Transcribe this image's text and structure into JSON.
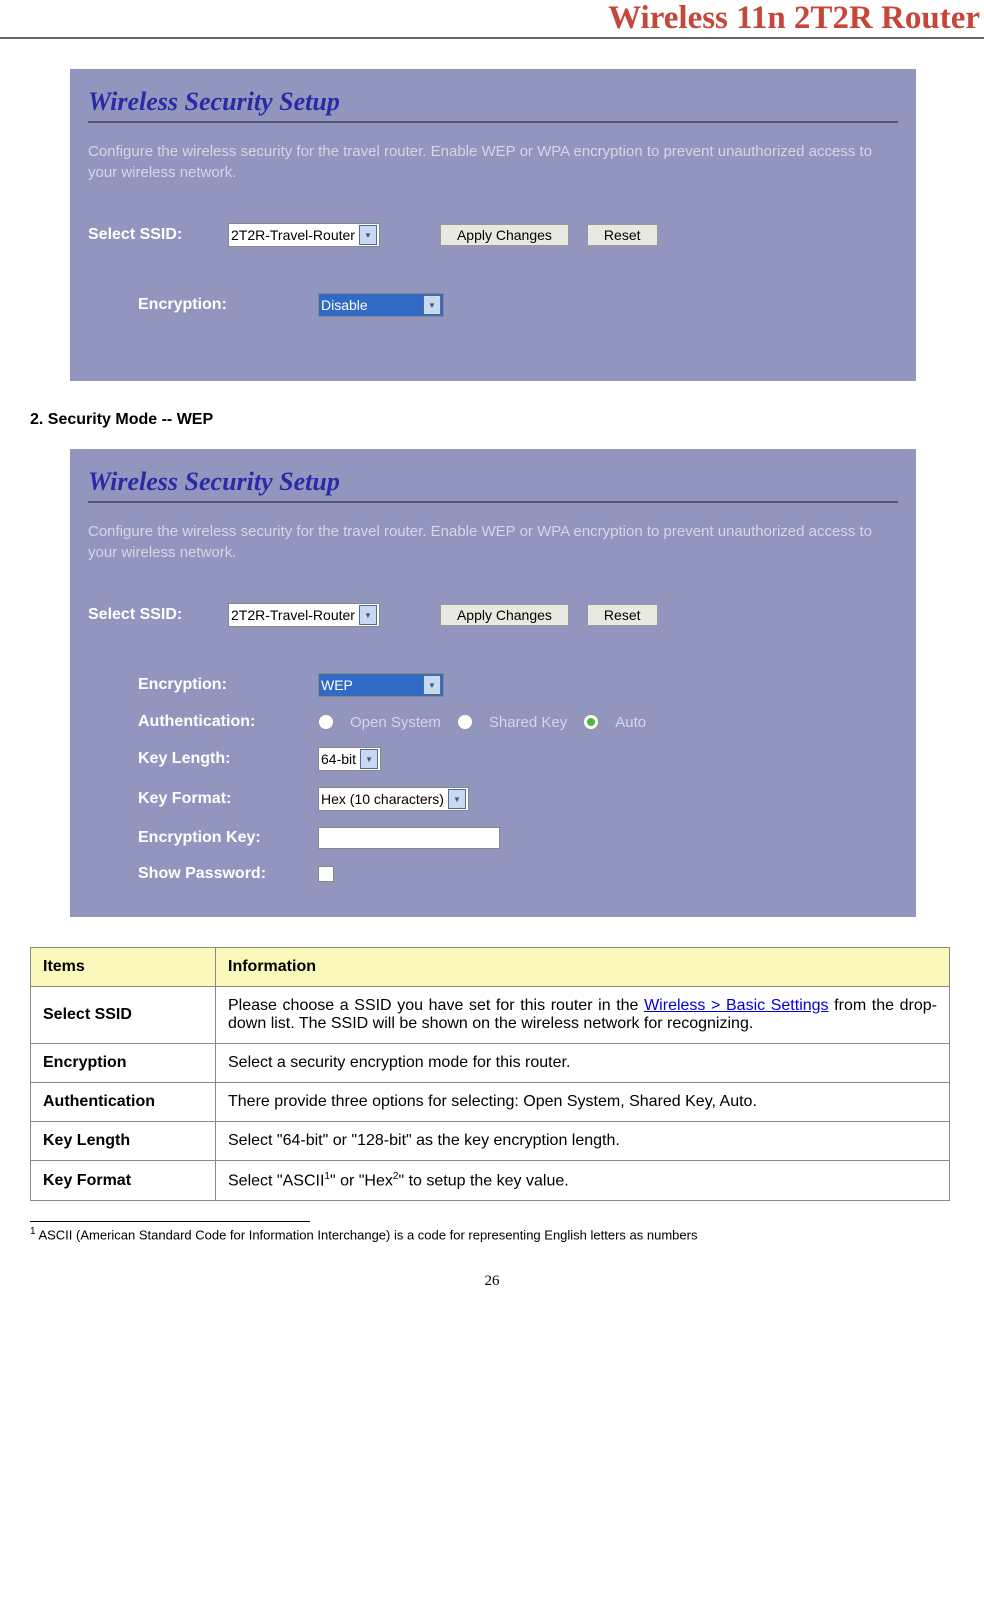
{
  "header": {
    "title": "Wireless 11n 2T2R Router"
  },
  "screenshot1": {
    "title": "Wireless Security Setup",
    "description": "Configure the wireless security for the travel router. Enable WEP or WPA encryption to prevent unauthorized access to your wireless network.",
    "ssid_label": "Select SSID:",
    "ssid_value": "2T2R-Travel-Router",
    "apply_btn": "Apply Changes",
    "reset_btn": "Reset",
    "encryption_label": "Encryption:",
    "encryption_value": "Disable"
  },
  "section_heading": "2.  Security Mode -- WEP",
  "screenshot2": {
    "title": "Wireless Security Setup",
    "description": "Configure the wireless security for the travel router. Enable WEP or WPA encryption to prevent unauthorized access to your wireless network.",
    "ssid_label": "Select SSID:",
    "ssid_value": "2T2R-Travel-Router",
    "apply_btn": "Apply Changes",
    "reset_btn": "Reset",
    "encryption_label": "Encryption:",
    "encryption_value": "WEP",
    "auth_label": "Authentication:",
    "auth_open": "Open System",
    "auth_shared": "Shared Key",
    "auth_auto": "Auto",
    "keylen_label": "Key Length:",
    "keylen_value": "64-bit",
    "keyfmt_label": "Key Format:",
    "keyfmt_value": "Hex (10 characters)",
    "enckey_label": "Encryption Key:",
    "showpw_label": "Show Password:"
  },
  "table": {
    "header_items": "Items",
    "header_info": "Information",
    "rows": [
      {
        "item": "Select SSID",
        "info_pre": "Please choose a SSID you have set for this router in the ",
        "info_link": "Wireless > Basic Settings",
        "info_post": " from the drop-down list. The SSID will be shown on the wireless network for recognizing."
      },
      {
        "item": "Encryption",
        "info": "Select a security encryption mode for this router."
      },
      {
        "item": "Authentication",
        "info": "There provide three options for selecting: Open System, Shared Key, Auto."
      },
      {
        "item": "Key Length",
        "info": "Select \"64-bit\" or \"128-bit\" as the key encryption length."
      },
      {
        "item": "Key Format",
        "info_pre": "Select \"ASCII",
        "info_sup1": "1",
        "info_mid": "\" or \"Hex",
        "info_sup2": "2",
        "info_post": "\" to setup the key value."
      }
    ]
  },
  "footnote": {
    "num": "1",
    "text": " ASCII (American Standard Code for Information Interchange) is a code for representing English letters as numbers"
  },
  "page_number": "26"
}
